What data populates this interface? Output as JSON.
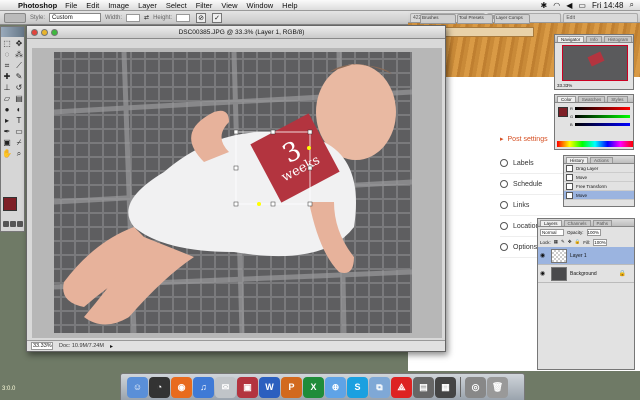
{
  "menubar": {
    "app": "Photoshop",
    "items": [
      "File",
      "Edit",
      "Image",
      "Layer",
      "Select",
      "Filter",
      "View",
      "Window",
      "Help"
    ],
    "clock": "Fri 14:48"
  },
  "options": {
    "style_label": "Style:",
    "style_value": "Custom",
    "width_label": "Width:",
    "height_label": "Height:"
  },
  "palette_tabs": [
    "Brushes",
    "Tool Presets",
    "Layer Comps"
  ],
  "document": {
    "title": "DSC00385.JPG @ 33.3% (Layer 1, RGB/8)",
    "zoom": "33.33%",
    "info": "Doc: 10.9M/7.24M"
  },
  "label": {
    "number": "3",
    "word": "weeks"
  },
  "browser": {
    "post_settings": "Post settings",
    "items": [
      "Labels",
      "Schedule",
      "Links",
      "Location",
      "Options"
    ]
  },
  "navigator": {
    "tabs": [
      "Navigator",
      "Info",
      "Histogram"
    ],
    "zoom": "33.33%"
  },
  "color_panel": {
    "tabs": [
      "Color",
      "Swatches",
      "Styles"
    ],
    "channels": [
      "R",
      "G",
      "B"
    ]
  },
  "history": {
    "tabs": [
      "History",
      "Actions"
    ],
    "items": [
      "Drag Layer",
      "Move",
      "Free Transform",
      "Move"
    ]
  },
  "layers": {
    "tabs": [
      "Layers",
      "Channels",
      "Paths"
    ],
    "mode": "Normal",
    "opacity_label": "Opacity:",
    "opacity": "100%",
    "lock_label": "Lock:",
    "fill_label": "Fill:",
    "fill": "100%",
    "rows": [
      "Layer 1",
      "Background"
    ]
  },
  "dock_icons": [
    "finder-icon",
    "dashboard-icon",
    "firefox-icon",
    "itunes-icon",
    "mail-icon",
    "photoshop-icon",
    "word-icon",
    "powerpoint-icon",
    "excel-icon",
    "safari-icon",
    "skype-icon",
    "preview-icon",
    "acrobat-icon",
    "app-icon",
    "app-icon",
    "utility-icon",
    "trash-icon"
  ],
  "bottom_left_text": "3:0.0"
}
